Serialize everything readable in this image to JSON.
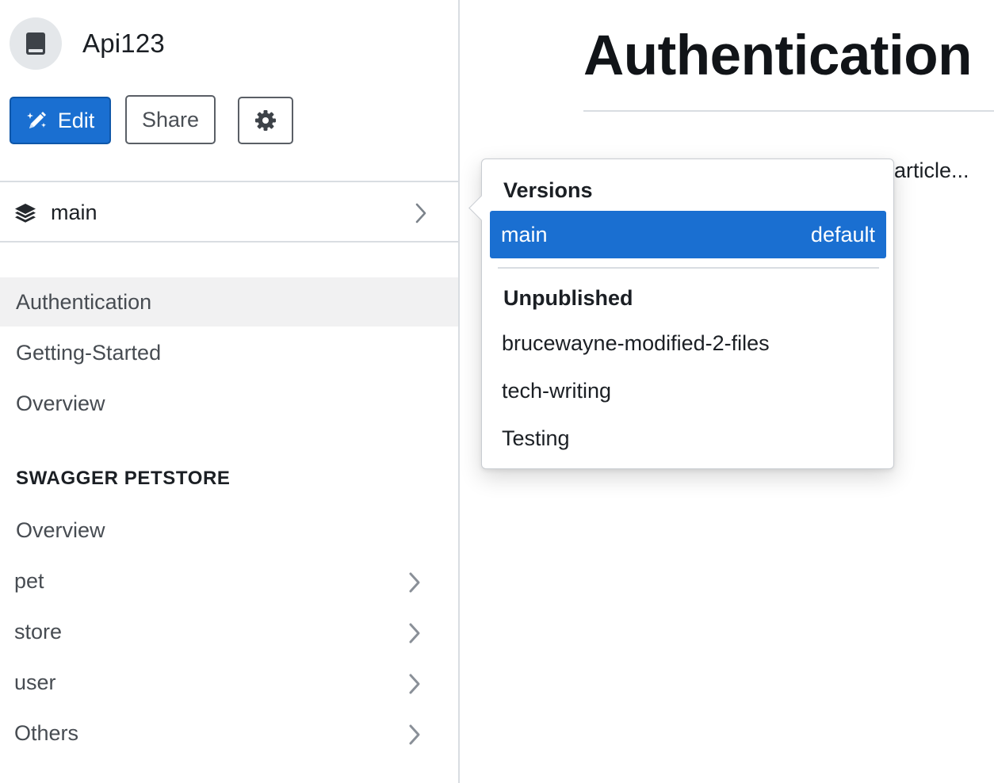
{
  "project": {
    "name": "Api123",
    "icon": "book-icon"
  },
  "toolbar": {
    "edit_label": "Edit",
    "share_label": "Share",
    "settings_icon": "gear-icon"
  },
  "version_selector": {
    "label": "main",
    "icon": "layers-icon"
  },
  "nav": {
    "items": [
      "Authentication",
      "Getting-Started",
      "Overview"
    ],
    "active": "Authentication",
    "section": {
      "heading": "SWAGGER PETSTORE",
      "items": [
        {
          "label": "Overview",
          "expandable": false
        },
        {
          "label": "pet",
          "expandable": true
        },
        {
          "label": "store",
          "expandable": true
        },
        {
          "label": "user",
          "expandable": true
        },
        {
          "label": "Others",
          "expandable": true
        }
      ]
    }
  },
  "main": {
    "title": "Authentication",
    "text_fragment": "article..."
  },
  "versions_popover": {
    "heading": "Versions",
    "selected": {
      "name": "main",
      "tag": "default"
    },
    "unpublished_heading": "Unpublished",
    "unpublished": [
      "brucewayne-modified-2-files",
      "tech-writing",
      "Testing"
    ]
  },
  "colors": {
    "accent": "#1a6fd1",
    "active_nav_bg": "#f1f1f2",
    "border": "#d9dde2"
  }
}
